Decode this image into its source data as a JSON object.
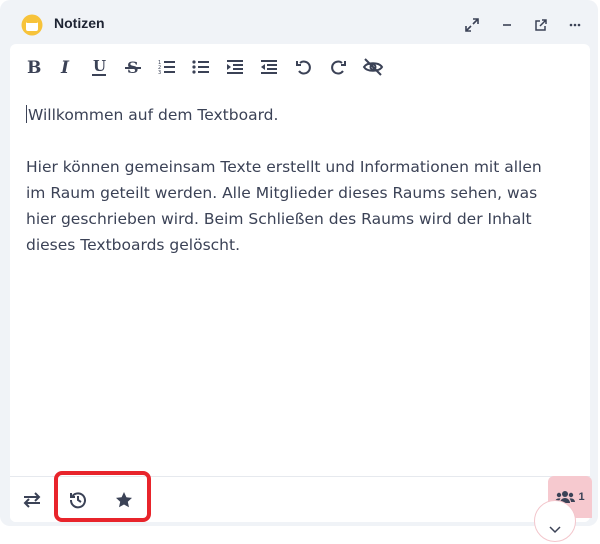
{
  "header": {
    "title": "Notizen",
    "icons": [
      "expand-icon",
      "minimize-icon",
      "external-link-icon",
      "more-icon"
    ]
  },
  "toolbar": {
    "items": [
      "bold",
      "italic",
      "underline",
      "strikethrough",
      "ordered-list",
      "bullet-list",
      "indent",
      "outdent",
      "undo",
      "redo",
      "hide"
    ]
  },
  "editor": {
    "line1": "Willkommen auf dem Textboard.",
    "paragraph2": "Hier können gemeinsam Texte erstellt und Informationen mit allen im Raum geteilt werden. Alle Mitglieder dieses Raums sehen, was hier geschrieben wird. Beim Schließen des Raums wird der Inhalt dieses Textboards gelöscht."
  },
  "footer": {
    "members_count": "1"
  },
  "colors": {
    "accent_highlight": "#e8242b",
    "members_bg": "#f6c9cf",
    "text": "#3b4256",
    "panel_bg": "#f0f3f7"
  }
}
